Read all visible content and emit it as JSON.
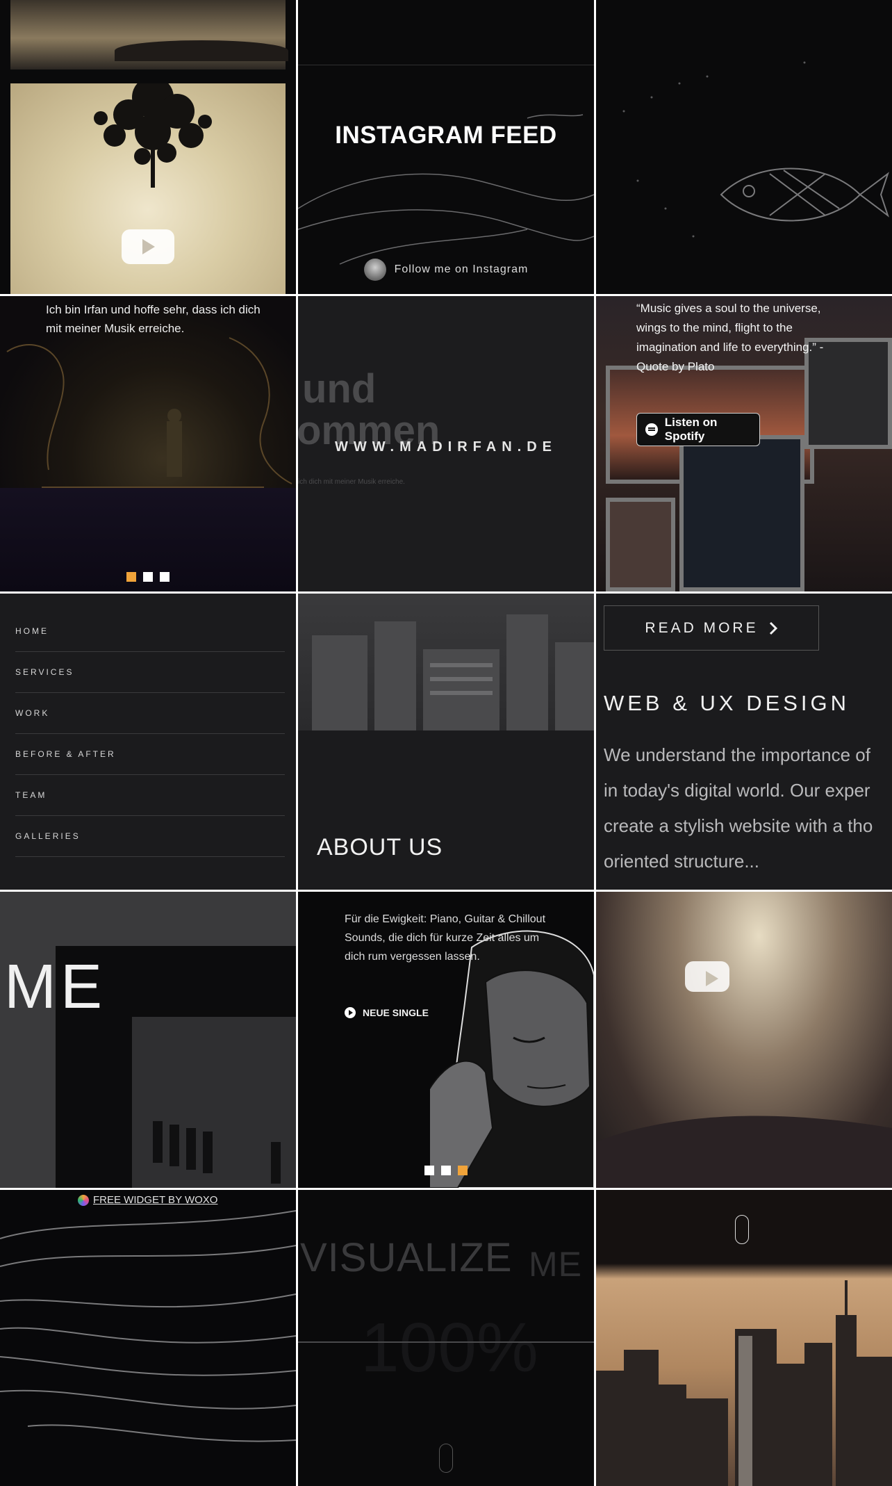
{
  "instagram": {
    "title": "INSTAGRAM FEED",
    "follow_label": "Follow me on Instagram"
  },
  "posts": {
    "cave": {
      "caption": "Ich bin Irfan und hoffe sehr, dass ich dich mit meiner Musik erreiche.",
      "carousel_active_index": 0,
      "carousel_count": 3
    },
    "madirfan": {
      "big_text_1": "und",
      "big_text_2": "ommen",
      "url": "WWW.MADIRFAN.DE",
      "small_text": "ich dich mit meiner Musik erreiche."
    },
    "plato": {
      "quote": "“Music gives a soul to the universe, wings to the mind, flight to the imagination and life to everything.” - Quote by Plato",
      "spotify_button": "Listen on Spotify"
    },
    "menu": {
      "items": [
        "HOME",
        "SERVICES",
        "WORK",
        "BEFORE & AFTER",
        "TEAM",
        "GALLERIES"
      ]
    },
    "about": {
      "title": "ABOUT US"
    },
    "web": {
      "read_more": "READ MORE",
      "title": "WEB & UX DESIGN",
      "body_lines": [
        "We understand the importance of",
        "in today's digital world. Our exper",
        "create a stylish website with a tho",
        "oriented structure..."
      ]
    },
    "me": {
      "text": "ME"
    },
    "single": {
      "text": "Für die Ewigkeit: Piano, Guitar & Chillout Sounds, die dich für kurze Zeit alles um dich rum vergessen lassen.",
      "button": "NEUE SINGLE",
      "carousel_active_index": 2,
      "carousel_count": 3
    },
    "visualize": {
      "text": "VISUALIZE",
      "me": "ME",
      "percent": "100%"
    },
    "woxo": {
      "label": "FREE WIDGET BY WOXO"
    }
  },
  "colors": {
    "accent": "#f0a33a",
    "tile_dark": "#1b1b1d",
    "separator": "#ffffff"
  },
  "icons": [
    "youtube-play-icon",
    "spotify-icon",
    "chevron-right-icon",
    "play-circle-icon",
    "woxo-logo-icon",
    "scroll-mouse-icon"
  ]
}
